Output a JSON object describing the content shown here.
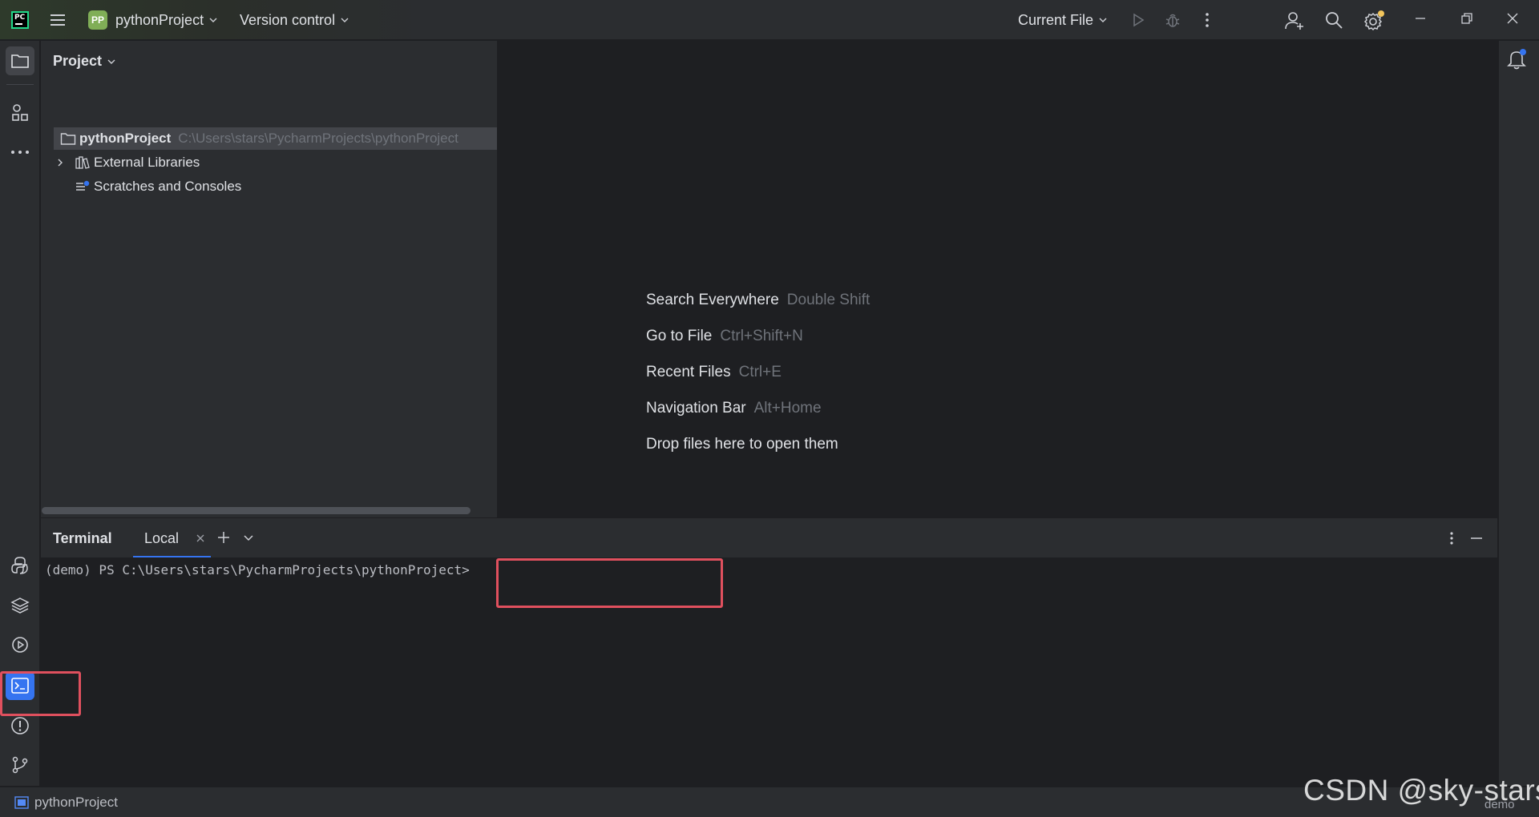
{
  "titlebar": {
    "project_badge": "PP",
    "project_name": "pythonProject",
    "vcs_label": "Version control",
    "run_config": "Current File"
  },
  "project_panel": {
    "title": "Project",
    "tree": [
      {
        "label": "pythonProject",
        "path": "C:\\Users\\stars\\PycharmProjects\\pythonProject"
      },
      {
        "label": "External Libraries"
      },
      {
        "label": "Scratches and Consoles"
      }
    ]
  },
  "editor_hints": [
    {
      "label": "Search Everywhere",
      "key": "Double Shift"
    },
    {
      "label": "Go to File",
      "key": "Ctrl+Shift+N"
    },
    {
      "label": "Recent Files",
      "key": "Ctrl+E"
    },
    {
      "label": "Navigation Bar",
      "key": "Alt+Home"
    },
    {
      "label": "Drop files here to open them",
      "key": ""
    }
  ],
  "terminal": {
    "title": "Terminal",
    "tab": "Local",
    "prompt": "(demo) PS C:\\Users\\stars\\PycharmProjects\\pythonProject>"
  },
  "statusbar": {
    "project": "pythonProject",
    "env": "demo"
  },
  "watermark": "CSDN @sky-stars",
  "colors": {
    "accent": "#3574f0",
    "highlight": "#e0505e",
    "project_badge": "#80ae57",
    "background": "#1e1f22",
    "panel": "#2b2d30"
  }
}
